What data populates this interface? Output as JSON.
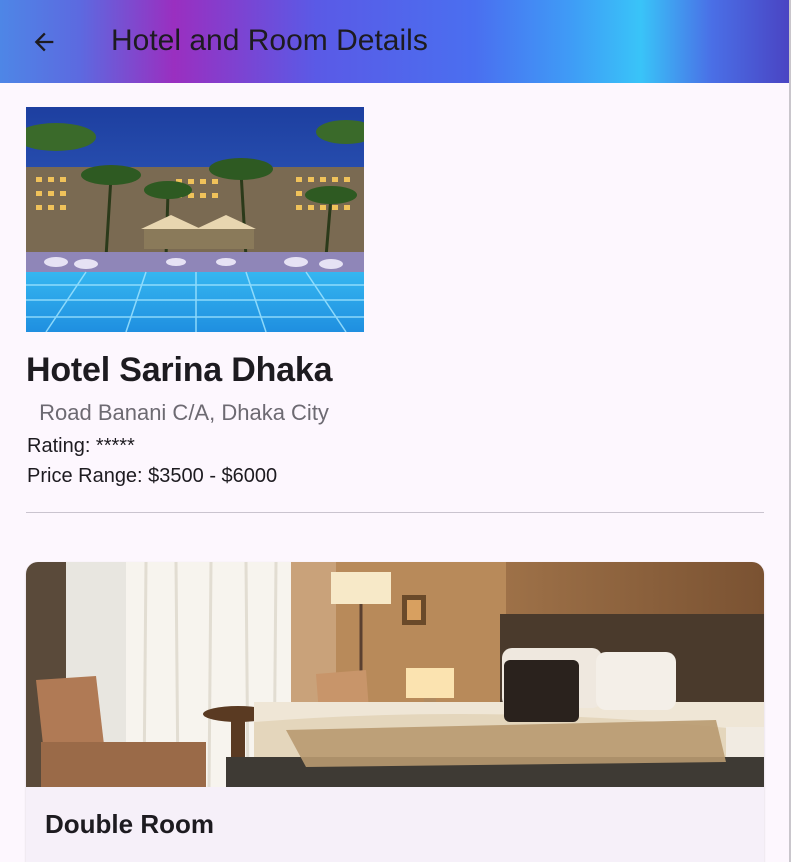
{
  "appbar": {
    "title": "Hotel and Room Details",
    "back_icon": "arrow-back-icon"
  },
  "hotel": {
    "image_alt": "hotel-pool-photo",
    "name": "Hotel Sarina Dhaka",
    "address": " Road Banani C/A, Dhaka City",
    "rating": "Rating: *****",
    "price_range": "Price Range: $3500 - $6000"
  },
  "rooms": [
    {
      "name": "Double Room",
      "image_alt": "room-bed-photo"
    }
  ],
  "colors": {
    "background": "#fdf7fe",
    "text_primary": "#1d1b20",
    "text_secondary": "#6d6a72",
    "card_background": "#f6f0f9",
    "divider": "#cac4cf"
  }
}
